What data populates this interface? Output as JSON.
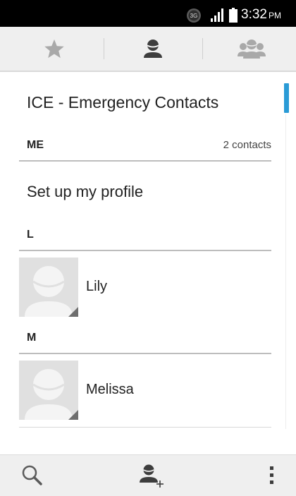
{
  "status_bar": {
    "network": "3G",
    "time": "3:32",
    "ampm": "PM"
  },
  "tabs": [
    {
      "name": "favorites",
      "icon": "star-icon",
      "selected": false
    },
    {
      "name": "contacts",
      "icon": "person-icon",
      "selected": true
    },
    {
      "name": "groups",
      "icon": "group-icon",
      "selected": false
    }
  ],
  "content": {
    "ice_title": "ICE - Emergency Contacts",
    "me_section": {
      "letter": "ME",
      "count": "2 contacts"
    },
    "profile_label": "Set up my profile",
    "sections": [
      {
        "letter": "L",
        "contacts": [
          {
            "name": "Lily"
          }
        ]
      },
      {
        "letter": "M",
        "contacts": [
          {
            "name": "Melissa"
          }
        ]
      }
    ]
  },
  "bottom_bar": {
    "search_icon": "search-icon",
    "add_icon": "add-contact-icon",
    "more_icon": "overflow-menu-icon"
  },
  "colors": {
    "accent": "#2a9bd6",
    "status_bar": "#000000",
    "tab_bar": "#efefef",
    "icon_gray": "#a9a9a9",
    "icon_dark": "#3d3d3d",
    "avatar_bg": "#e0e0e0"
  }
}
